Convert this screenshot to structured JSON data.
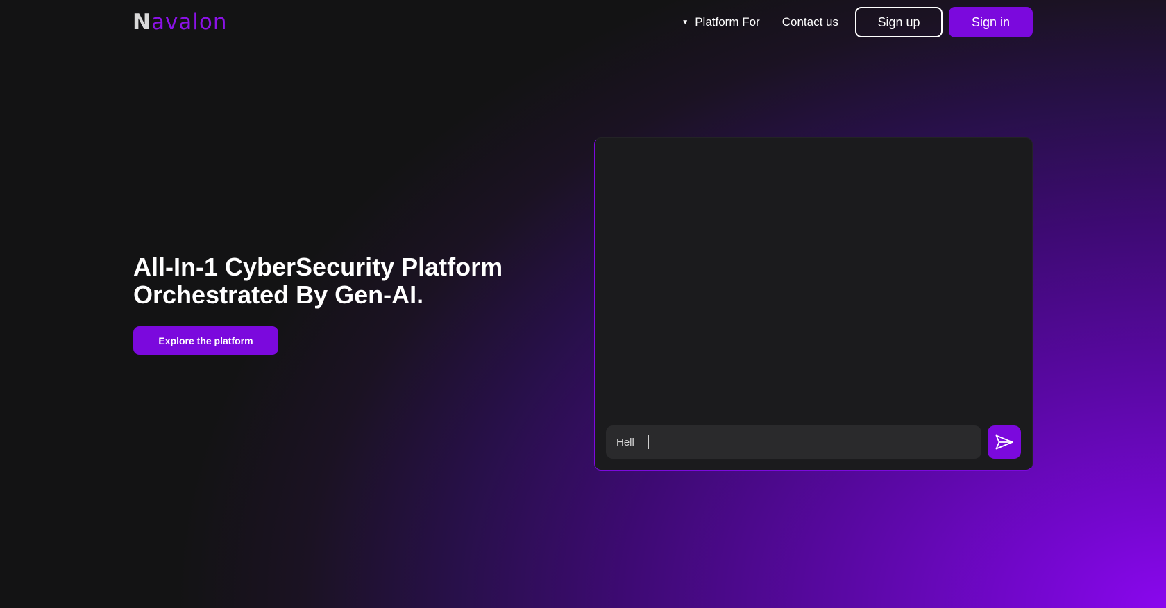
{
  "brand": {
    "logo_first": "N",
    "logo_rest": "avalon"
  },
  "nav": {
    "platform_caret": "▼",
    "platform_label": "Platform For",
    "contact_label": "Contact us",
    "signup_label": "Sign up",
    "signin_label": "Sign in"
  },
  "hero": {
    "title": "All-In-1 CyberSecurity Platform\nOrchestrated By Gen-AI.",
    "cta_label": "Explore the platform"
  },
  "chat": {
    "input_value": "Hell",
    "send_icon": "send-icon"
  },
  "colors": {
    "accent": "#7b09dd",
    "background": "#131314",
    "panel": "#1b1b1d",
    "input": "#2a2a2c"
  }
}
